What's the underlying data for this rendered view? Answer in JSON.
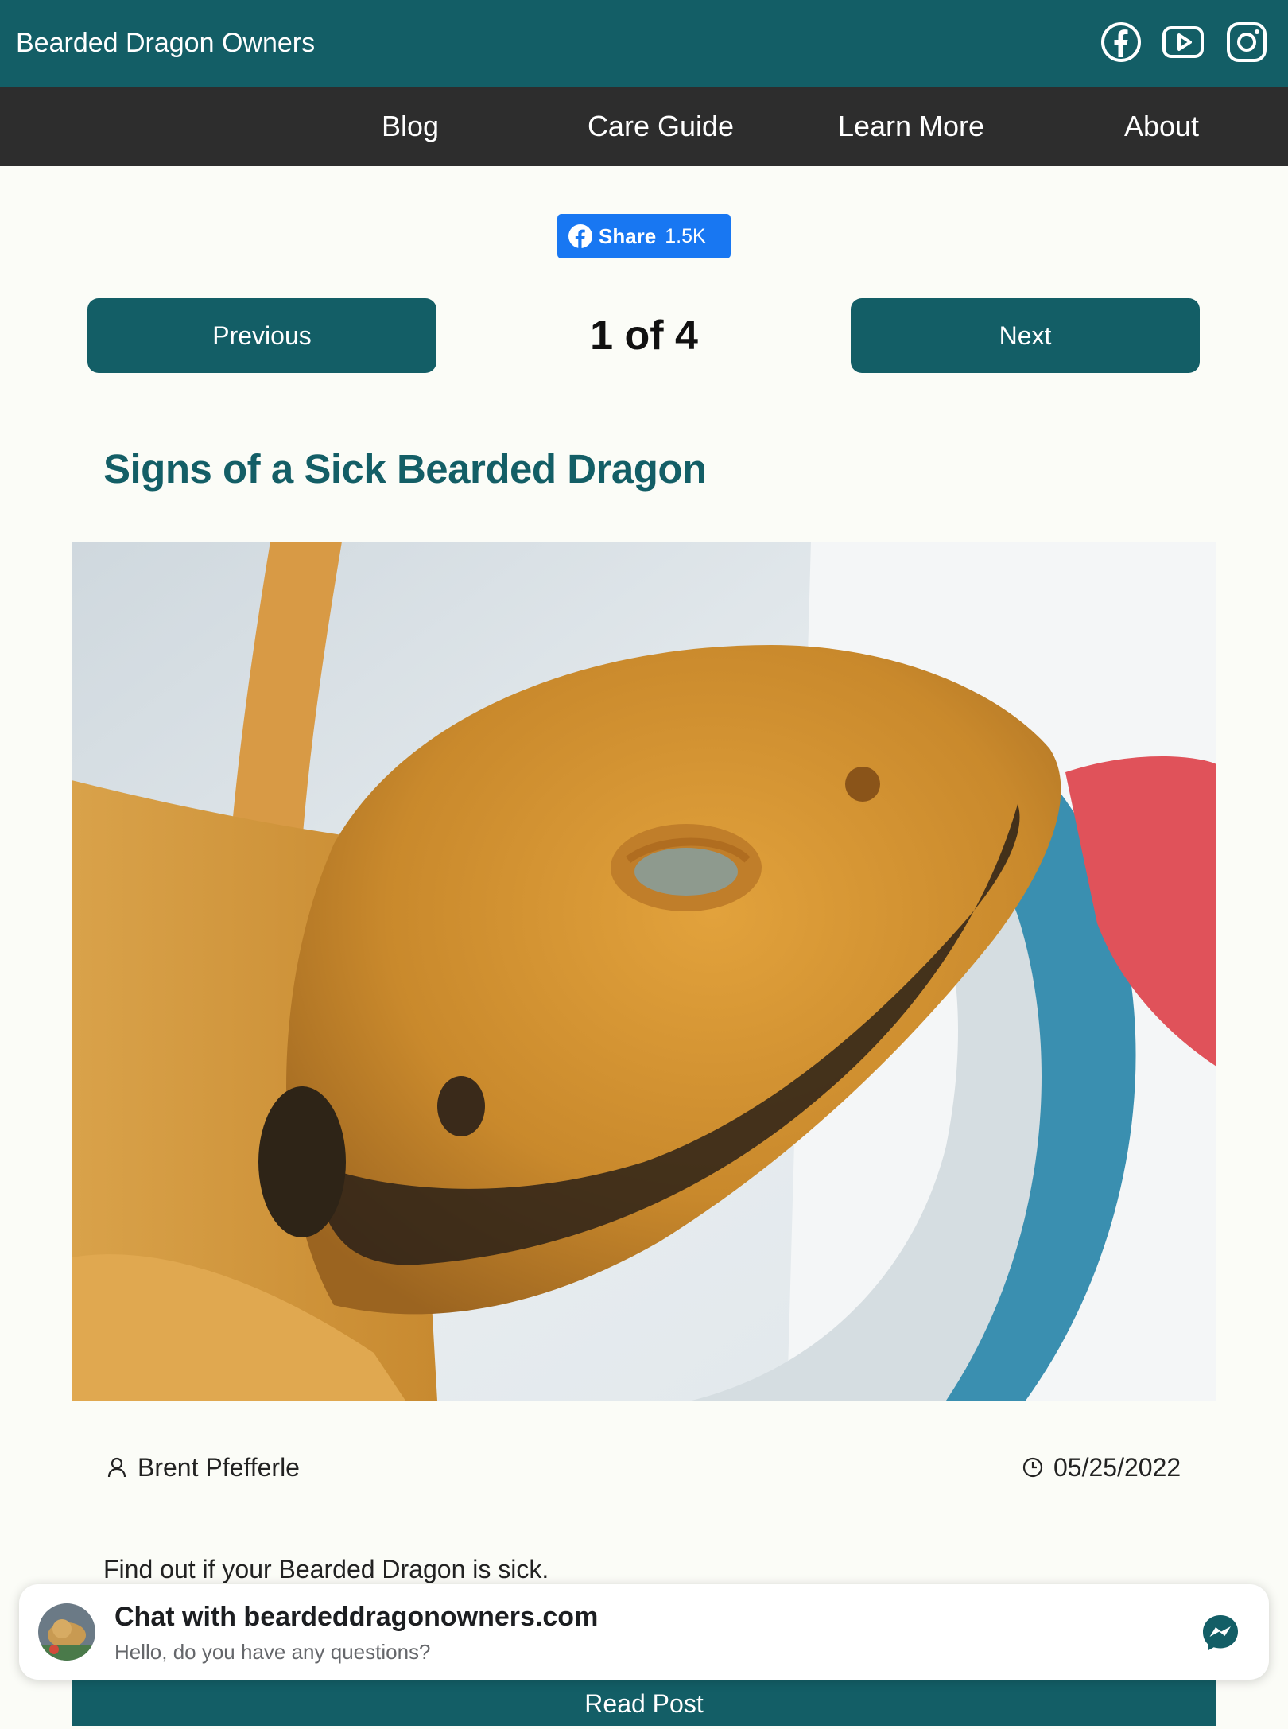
{
  "header": {
    "site_title": "Bearded Dragon Owners",
    "social_icons": [
      "facebook-icon",
      "youtube-icon",
      "instagram-icon"
    ],
    "bg_color": "#135e66"
  },
  "nav": {
    "items": [
      {
        "label": "Blog"
      },
      {
        "label": "Care Guide"
      },
      {
        "label": "Learn More"
      },
      {
        "label": "About"
      }
    ],
    "bg_color": "#2d2d2d"
  },
  "share": {
    "label": "Share",
    "count": "1.5K"
  },
  "pager": {
    "previous_label": "Previous",
    "status": "1 of 4",
    "next_label": "Next"
  },
  "post": {
    "title": "Signs of a Sick Bearded Dragon",
    "author": "Brent Pfefferle",
    "date": "05/25/2022",
    "excerpt": "Find out if your Bearded Dragon is sick.",
    "read_label": "Read Post"
  },
  "chat": {
    "title": "Chat with beardeddragonowners.com",
    "subtitle": "Hello, do you have any questions?"
  },
  "colors": {
    "accent": "#135e66",
    "facebook": "#1877f2",
    "page_bg": "#fbfcf7"
  }
}
